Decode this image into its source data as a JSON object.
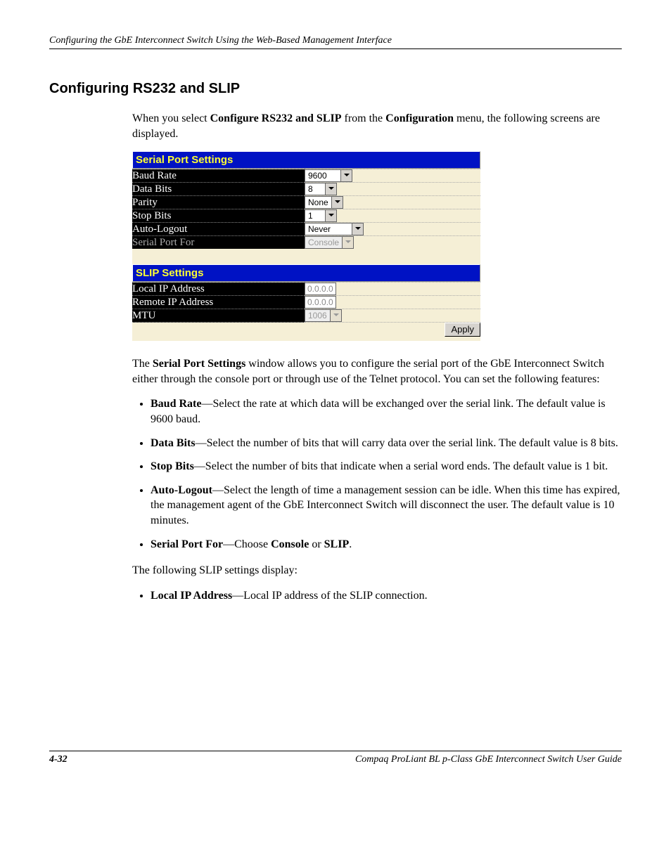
{
  "header": "Configuring the GbE Interconnect Switch Using the Web-Based Management Interface",
  "h2": "Configuring RS232 and SLIP",
  "intro_pre": "When you select ",
  "intro_b1": "Configure RS232 and SLIP",
  "intro_mid": " from the ",
  "intro_b2": "Configuration",
  "intro_post": " menu, the following screens are displayed.",
  "serial_header": "Serial Port Settings",
  "serial": {
    "baud_label": "Baud Rate",
    "baud_value": "9600",
    "data_label": "Data Bits",
    "data_value": "8",
    "parity_label": "Parity",
    "parity_value": "None",
    "stop_label": "Stop Bits",
    "stop_value": "1",
    "auto_label": "Auto-Logout",
    "auto_value": "Never",
    "portfor_label": "Serial Port For",
    "portfor_value": "Console"
  },
  "slip_header": "SLIP Settings",
  "slip": {
    "local_label": "Local IP Address",
    "local_value": "0.0.0.0",
    "remote_label": "Remote IP Address",
    "remote_value": "0.0.0.0",
    "mtu_label": "MTU",
    "mtu_value": "1006"
  },
  "apply_label": "Apply",
  "p2_pre": "The ",
  "p2_b": "Serial Port Settings",
  "p2_post": " window allows you to configure the serial port of the GbE Interconnect Switch either through the console port or through use of the Telnet protocol. You can set the following features:",
  "b_baud_name": "Baud Rate",
  "b_baud_text": "—Select the rate at which data will be exchanged over the serial link. The default value is 9600 baud.",
  "b_data_name": "Data Bits",
  "b_data_text": "—Select the number of bits that will carry data over the serial link. The default value is 8 bits.",
  "b_stop_name": "Stop Bits",
  "b_stop_text": "—Select the number of bits that indicate when a serial word ends. The default value is 1 bit.",
  "b_auto_name": "Auto-Logout",
  "b_auto_text": "—Select the length of time a management session can be idle. When this time has expired, the management agent of the GbE Interconnect Switch will disconnect the user. The default value is 10 minutes.",
  "b_portfor_name": "Serial Port For",
  "b_portfor_mid": "—Choose ",
  "b_portfor_c": "Console",
  "b_portfor_or": " or ",
  "b_portfor_s": "SLIP",
  "b_portfor_end": ".",
  "p3": "The following SLIP settings display:",
  "b_local_name": "Local IP Address",
  "b_local_text": "—Local IP address of the SLIP connection.",
  "footer_page": "4-32",
  "footer_doc": "Compaq ProLiant BL p-Class GbE Interconnect Switch User Guide"
}
